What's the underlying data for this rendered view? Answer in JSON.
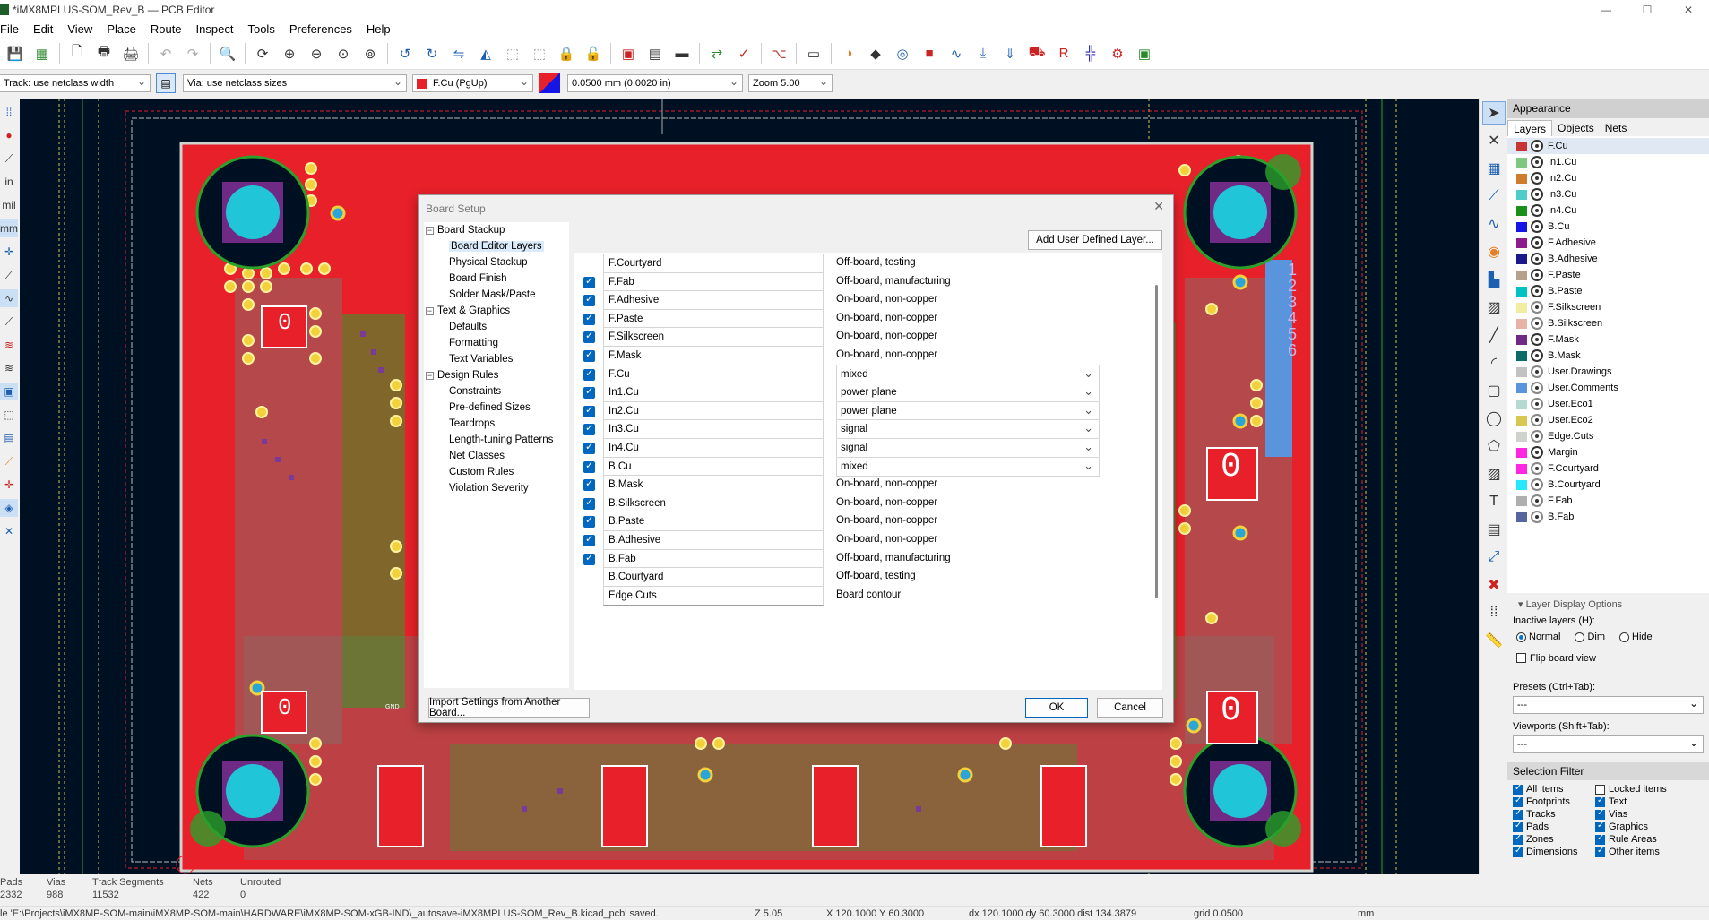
{
  "window": {
    "title": "*iMX8MPLUS-SOM_Rev_B — PCB Editor",
    "controls": [
      "—",
      "☐",
      "✕"
    ]
  },
  "menu": [
    "File",
    "Edit",
    "View",
    "Place",
    "Route",
    "Inspect",
    "Tools",
    "Preferences",
    "Help"
  ],
  "toolbar2": {
    "track": "Track: use netclass width",
    "via": "Via: use netclass sizes",
    "layer": "F.Cu (PgUp)",
    "grid": "0.0500 mm (0.0020 in)",
    "zoom": "Zoom 5.00"
  },
  "lefttool_labels": [
    "in",
    "mil",
    "mm"
  ],
  "dialog": {
    "title": "Board Setup",
    "tree": [
      {
        "label": "Board Stackup",
        "children": [
          "Board Editor Layers",
          "Physical Stackup",
          "Board Finish",
          "Solder Mask/Paste"
        ]
      },
      {
        "label": "Text & Graphics",
        "children": [
          "Defaults",
          "Formatting",
          "Text Variables"
        ]
      },
      {
        "label": "Design Rules",
        "children": [
          "Constraints",
          "Pre-defined Sizes",
          "Teardrops",
          "Length-tuning Patterns",
          "Net Classes",
          "Custom Rules",
          "Violation Severity"
        ]
      }
    ],
    "selected_item": "Board Editor Layers",
    "add_button": "Add User Defined Layer...",
    "layers": [
      {
        "name": "F.Courtyard",
        "checked": false,
        "type": "Off-board, testing",
        "dropdown": false
      },
      {
        "name": "F.Fab",
        "checked": true,
        "type": "Off-board, manufacturing",
        "dropdown": false
      },
      {
        "name": "F.Adhesive",
        "checked": true,
        "type": "On-board, non-copper",
        "dropdown": false
      },
      {
        "name": "F.Paste",
        "checked": true,
        "type": "On-board, non-copper",
        "dropdown": false
      },
      {
        "name": "F.Silkscreen",
        "checked": true,
        "type": "On-board, non-copper",
        "dropdown": false
      },
      {
        "name": "F.Mask",
        "checked": true,
        "type": "On-board, non-copper",
        "dropdown": false
      },
      {
        "name": "F.Cu",
        "checked": true,
        "type": "mixed",
        "dropdown": true
      },
      {
        "name": "In1.Cu",
        "checked": true,
        "type": "power plane",
        "dropdown": true
      },
      {
        "name": "In2.Cu",
        "checked": true,
        "type": "power plane",
        "dropdown": true
      },
      {
        "name": "In3.Cu",
        "checked": true,
        "type": "signal",
        "dropdown": true
      },
      {
        "name": "In4.Cu",
        "checked": true,
        "type": "signal",
        "dropdown": true
      },
      {
        "name": "B.Cu",
        "checked": true,
        "type": "mixed",
        "dropdown": true
      },
      {
        "name": "B.Mask",
        "checked": true,
        "type": "On-board, non-copper",
        "dropdown": false
      },
      {
        "name": "B.Silkscreen",
        "checked": true,
        "type": "On-board, non-copper",
        "dropdown": false
      },
      {
        "name": "B.Paste",
        "checked": true,
        "type": "On-board, non-copper",
        "dropdown": false
      },
      {
        "name": "B.Adhesive",
        "checked": true,
        "type": "On-board, non-copper",
        "dropdown": false
      },
      {
        "name": "B.Fab",
        "checked": true,
        "type": "Off-board, manufacturing",
        "dropdown": false
      },
      {
        "name": "B.Courtyard",
        "checked": false,
        "type": "Off-board, testing",
        "dropdown": false
      },
      {
        "name": "Edge.Cuts",
        "checked": false,
        "type": "Board contour",
        "dropdown": false
      }
    ],
    "import_button": "Import Settings from Another Board...",
    "ok": "OK",
    "cancel": "Cancel"
  },
  "appearance": {
    "title": "Appearance",
    "tabs": [
      "Layers",
      "Objects",
      "Nets"
    ],
    "layers": [
      {
        "name": "F.Cu",
        "color": "#c83434",
        "visible": true
      },
      {
        "name": "In1.Cu",
        "color": "#7fc87f",
        "visible": true
      },
      {
        "name": "In2.Cu",
        "color": "#ce7d2c",
        "visible": true
      },
      {
        "name": "In3.Cu",
        "color": "#4fcbcb",
        "visible": true
      },
      {
        "name": "In4.Cu",
        "color": "#1a8f1a",
        "visible": true
      },
      {
        "name": "B.Cu",
        "color": "#1515e6",
        "visible": true
      },
      {
        "name": "F.Adhesive",
        "color": "#8c1c8c",
        "visible": true
      },
      {
        "name": "B.Adhesive",
        "color": "#1a1a8c",
        "visible": true
      },
      {
        "name": "F.Paste",
        "color": "#b4a08c",
        "visible": true
      },
      {
        "name": "B.Paste",
        "color": "#00c2c2",
        "visible": true
      },
      {
        "name": "F.Silkscreen",
        "color": "#f2eda1",
        "visible": false
      },
      {
        "name": "B.Silkscreen",
        "color": "#e8b2a7",
        "visible": false
      },
      {
        "name": "F.Mask",
        "color": "#6e2a84",
        "visible": true
      },
      {
        "name": "B.Mask",
        "color": "#0c6b66",
        "visible": true
      },
      {
        "name": "User.Drawings",
        "color": "#c2c2c2",
        "visible": false
      },
      {
        "name": "User.Comments",
        "color": "#5994dc",
        "visible": false
      },
      {
        "name": "User.Eco1",
        "color": "#b4dbd2",
        "visible": false
      },
      {
        "name": "User.Eco2",
        "color": "#d8c852",
        "visible": false
      },
      {
        "name": "Edge.Cuts",
        "color": "#d0d2cd",
        "visible": false
      },
      {
        "name": "Margin",
        "color": "#ff26e2",
        "visible": true
      },
      {
        "name": "F.Courtyard",
        "color": "#ff26e2",
        "visible": false
      },
      {
        "name": "B.Courtyard",
        "color": "#26e9ff",
        "visible": false
      },
      {
        "name": "F.Fab",
        "color": "#afafaf",
        "visible": false
      },
      {
        "name": "B.Fab",
        "color": "#58649e",
        "visible": false
      }
    ],
    "layer_display_options": "Layer Display Options",
    "inactive_layers_label": "Inactive layers (H):",
    "inactive_options": [
      "Normal",
      "Dim",
      "Hide"
    ],
    "flip_board": "Flip board view",
    "presets_label": "Presets (Ctrl+Tab):",
    "presets_value": "---",
    "viewports_label": "Viewports (Shift+Tab):",
    "viewports_value": "---",
    "selection_filter": "Selection Filter",
    "filters": [
      "All items",
      "Locked items",
      "Footprints",
      "Text",
      "Tracks",
      "Vias",
      "Pads",
      "Graphics",
      "Zones",
      "Rule Areas",
      "Dimensions",
      "Other items"
    ]
  },
  "status": {
    "cols": [
      {
        "h": "Pads",
        "v": "2332"
      },
      {
        "h": "Vias",
        "v": "988"
      },
      {
        "h": "Track Segments",
        "v": "11532"
      },
      {
        "h": "Nets",
        "v": "422"
      },
      {
        "h": "Unrouted",
        "v": "0"
      }
    ],
    "message": "le 'E:\\Projects\\iMX8MP-SOM-main\\iMX8MP-SOM-main\\HARDWARE\\iMX8MP-SOM-xGB-IND\\_autosave-iMX8MPLUS-SOM_Rev_B.kicad_pcb' saved.",
    "zoom": "Z 5.05",
    "xy": "X 120.1000  Y 60.3000",
    "dxy": "dx 120.1000  dy 60.3000  dist 134.3879",
    "grid": "grid 0.0500",
    "units": "mm"
  },
  "board_labels": {
    "zero": "0",
    "gnd": "GND",
    "digits": [
      "1",
      "2",
      "3",
      "4",
      "5",
      "6"
    ]
  },
  "colors": {
    "canvas": "#001023",
    "copper": "#e8202a",
    "pad": "#f2d13a",
    "mounting": "#20c6d8",
    "accent": "#0067c0"
  }
}
